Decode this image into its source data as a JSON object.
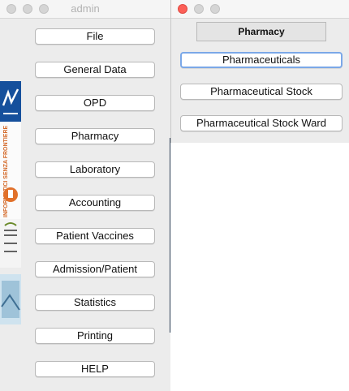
{
  "main_window": {
    "title": "admin",
    "menu_buttons": [
      {
        "label": "File"
      },
      {
        "label": "General Data"
      },
      {
        "label": "OPD"
      },
      {
        "label": "Pharmacy"
      },
      {
        "label": "Laboratory"
      },
      {
        "label": "Accounting"
      },
      {
        "label": "Patient Vaccines"
      },
      {
        "label": "Admission/Patient"
      },
      {
        "label": "Statistics"
      },
      {
        "label": "Printing"
      },
      {
        "label": "HELP"
      }
    ],
    "logo_text": "INFORMATICI SENZA FRONTIERE"
  },
  "pharmacy_window": {
    "title": "Pharmacy",
    "buttons": [
      {
        "label": "Pharmaceuticals"
      },
      {
        "label": "Pharmaceutical Stock"
      },
      {
        "label": "Pharmaceutical Stock Ward"
      }
    ]
  },
  "colors": {
    "close_red": "#fc5f57",
    "focus_ring": "#7ba8e8"
  }
}
